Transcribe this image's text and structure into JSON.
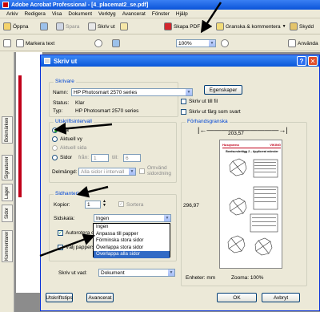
{
  "app": {
    "title": "Adobe Acrobat Professional - [4_placemat2_se.pdf]",
    "menu": [
      "Arkiv",
      "Redigera",
      "Visa",
      "Dokument",
      "Verktyg",
      "Avancerat",
      "Fönster",
      "Hjälp"
    ],
    "toolbar1": {
      "open": "Öppna",
      "save": "Spara",
      "print": "Skriv ut",
      "create_pdf": "Skapa PDF",
      "review": "Granska & kommentera",
      "secure": "Skydd"
    },
    "toolbar2": {
      "select_text": "Markera text",
      "zoom": "100%",
      "use": "Använda"
    },
    "side_tabs": [
      "Bokmärken",
      "Signaturer",
      "Lager",
      "Sidor",
      "Kommentarer"
    ]
  },
  "dialog": {
    "title": "Skriv ut",
    "printer": {
      "group_title": "Skrivare",
      "name_label": "Namn:",
      "name_value": "HP Photosmart 2570 series",
      "status_label": "Status:",
      "status_value": "Klar",
      "type_label": "Typ:",
      "type_value": "HP Photosmart 2570 series",
      "properties_button": "Egenskaper",
      "print_to_file": "Skriv ut till fil",
      "print_color_as_black": "Skriv ut färg som svart"
    },
    "range": {
      "group_title": "Utskriftsintervall",
      "all": "Alla",
      "current_view": "Aktuell vy",
      "current_page": "Aktuell sida",
      "pages": "Sidor",
      "from": "från:",
      "from_value": "1",
      "to": "till:",
      "to_value": "6",
      "subset_label": "Delmängd:",
      "subset_value": "Alla sidor i intervall",
      "reverse_pages": "Omvänd sidordning"
    },
    "handling": {
      "group_title": "Sidhantering",
      "copies_label": "Kopior:",
      "copies_value": "1",
      "collate": "Sortera",
      "scaling_label": "Sidskala:",
      "scaling_value": "Ingen",
      "autorotate": "Autorotera o",
      "choose_paper": "Välj pappers",
      "scaling_options": [
        "Ingen",
        "Anpassa till papper",
        "Förminska stora sidor",
        "Överlappa stora sidor",
        "Överlappa alla sidor"
      ],
      "selected_index": 4
    },
    "print_what_label": "Skriv ut vad:",
    "print_what_value": "Dokument",
    "preview": {
      "group_title": "Förhandsgranska",
      "width": "203,57",
      "height": "296,97",
      "unit_label": "Enheter: mm",
      "zoom_label": "Zooma: 100%",
      "page_brand": "Husqvarna",
      "page_brand2": "VIKING",
      "page_heading": "Bordsunderlägg 2 – Applicerat mönster"
    },
    "buttons": {
      "printing_tips": "Utskriftstips",
      "advanced": "Avancerat",
      "ok": "OK",
      "cancel": "Avbryt"
    }
  }
}
